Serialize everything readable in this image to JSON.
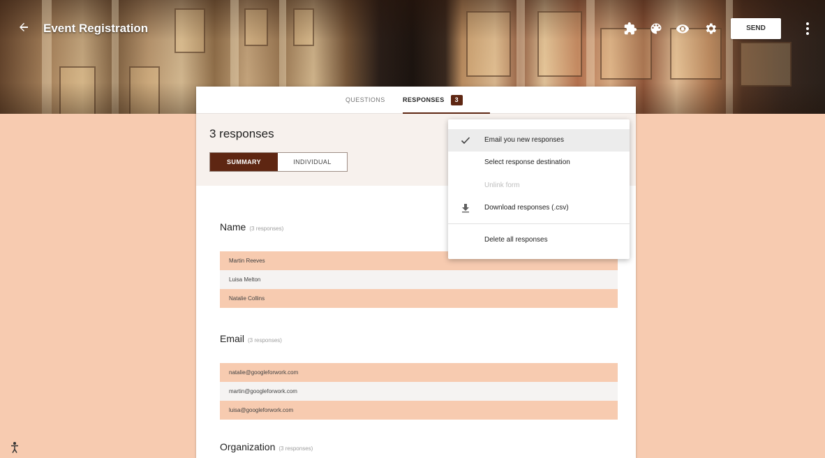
{
  "header": {
    "title": "Event Registration",
    "send_label": "SEND"
  },
  "tabs": {
    "questions": "QUESTIONS",
    "responses": "RESPONSES",
    "responses_count": "3"
  },
  "summary": {
    "count_text": "3 responses",
    "summary_label": "SUMMARY",
    "individual_label": "INDIVIDUAL"
  },
  "questions": [
    {
      "title": "Name",
      "meta": "(3 responses)",
      "answers": [
        "Martin Reeves",
        "Luisa Melton",
        "Natalie Collins"
      ]
    },
    {
      "title": "Email",
      "meta": "(3 responses)",
      "answers": [
        "natalie@googleforwork.com",
        "martin@googleforwork.com",
        "luisa@googleforwork.com"
      ]
    },
    {
      "title": "Organization",
      "meta": "(3 responses)"
    }
  ],
  "menu": {
    "items": [
      {
        "label": "Email you new responses",
        "icon": "check-icon",
        "selected": true
      },
      {
        "label": "Select response destination"
      },
      {
        "label": "Unlink form",
        "disabled": true
      },
      {
        "label": "Download responses (.csv)",
        "icon": "download-icon"
      },
      {
        "label": "Delete all responses"
      }
    ]
  },
  "colors": {
    "accent": "#5e2612",
    "background": "#f7cbb0"
  }
}
